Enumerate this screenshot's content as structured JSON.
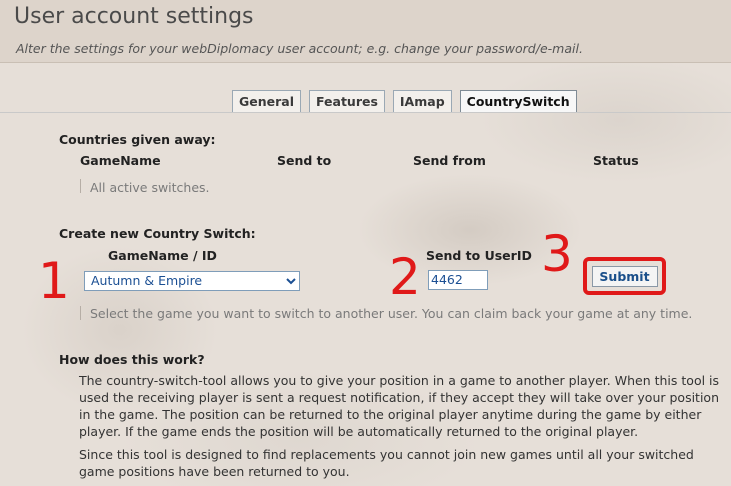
{
  "header": {
    "title": "User account settings",
    "subtitle": "Alter the settings for your webDiplomacy user account; e.g. change your password/e-mail."
  },
  "tabs": [
    {
      "label": "General",
      "active": false
    },
    {
      "label": "Features",
      "active": false
    },
    {
      "label": "IAmap",
      "active": false
    },
    {
      "label": "CountrySwitch",
      "active": true
    }
  ],
  "given_away": {
    "heading": "Countries given away:",
    "columns": [
      "GameName",
      "Send to",
      "Send from",
      "Status"
    ],
    "empty_text": "All active switches."
  },
  "create": {
    "heading": "Create new Country Switch:",
    "game_label": "GameName / ID",
    "game_selected": "Autumn & Empire",
    "userid_label": "Send to UserID",
    "userid_value": "4462",
    "submit_label": "Submit",
    "hint": "Select the game you want to switch to another user. You can claim back your game at any time."
  },
  "annotations": {
    "step1": "1",
    "step2": "2",
    "step3": "3",
    "color": "#e01919"
  },
  "help": {
    "heading": "How does this work?",
    "paragraph1": "The country-switch-tool allows you to give your position in a game to another player. When this tool is used the receiving player is sent a request notification, if they accept they will take over your position in the game. The position can be returned to the original player anytime during the game by either player. If the game ends the position will be automatically returned to the original player.",
    "paragraph2": "Since this tool is designed to find replacements you cannot join new games until all your switched game positions have been returned to you."
  }
}
